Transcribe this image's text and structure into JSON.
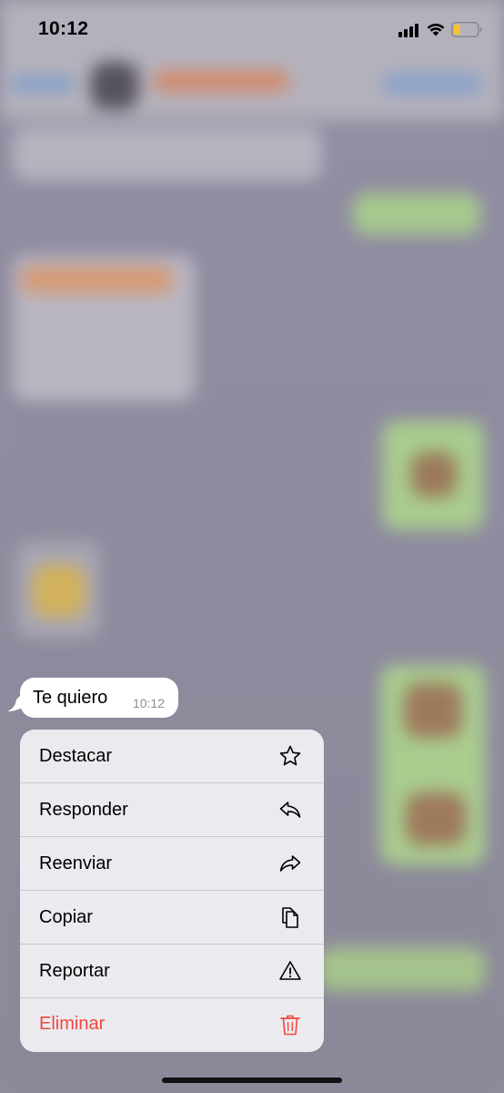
{
  "status_bar": {
    "time": "10:12",
    "icons": [
      "cellular-signal-icon",
      "wifi-icon",
      "battery-low-icon"
    ],
    "battery_color": "#f6c431"
  },
  "message": {
    "text": "Te quiero",
    "time": "10:12"
  },
  "context_menu": {
    "items": [
      {
        "label": "Destacar",
        "icon": "star-icon"
      },
      {
        "label": "Responder",
        "icon": "reply-icon"
      },
      {
        "label": "Reenviar",
        "icon": "forward-icon"
      },
      {
        "label": "Copiar",
        "icon": "copy-icon"
      },
      {
        "label": "Reportar",
        "icon": "warning-icon"
      },
      {
        "label": "Eliminar",
        "icon": "trash-icon",
        "color": "#f0483e"
      }
    ]
  }
}
